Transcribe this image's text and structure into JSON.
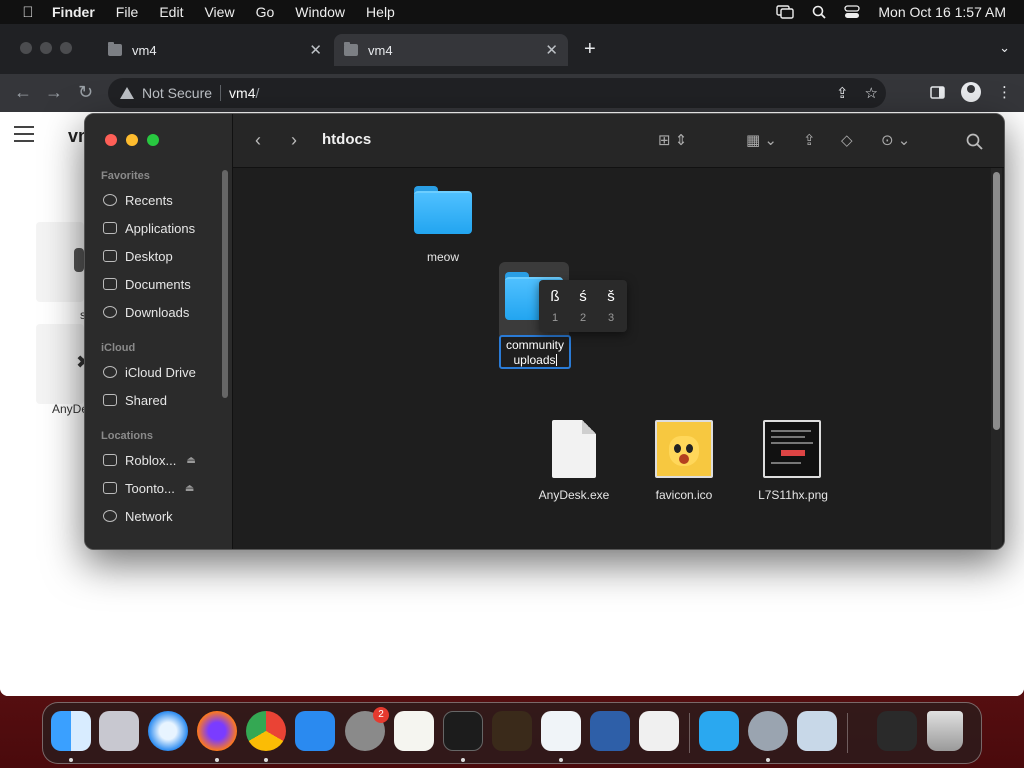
{
  "menubar": {
    "app_name": "Finder",
    "menus": [
      "File",
      "Edit",
      "View",
      "Go",
      "Window",
      "Help"
    ],
    "clock": "Mon Oct 16  1:57 AM"
  },
  "browser": {
    "tabs": [
      {
        "title": "vm4",
        "active": false
      },
      {
        "title": "vm4",
        "active": true
      }
    ],
    "address": {
      "security": "Not Secure",
      "host": "vm4",
      "path": "/"
    },
    "page": {
      "title_partial": "vm",
      "left_labels": [
        "s",
        "AnyDe"
      ]
    }
  },
  "finder": {
    "title": "htdocs",
    "sidebar": {
      "sections": [
        {
          "heading": "Favorites",
          "items": [
            {
              "label": "Recents",
              "icon": "clock-icon"
            },
            {
              "label": "Applications",
              "icon": "applications-icon"
            },
            {
              "label": "Desktop",
              "icon": "desktop-icon"
            },
            {
              "label": "Documents",
              "icon": "document-icon"
            },
            {
              "label": "Downloads",
              "icon": "download-icon"
            }
          ]
        },
        {
          "heading": "iCloud",
          "items": [
            {
              "label": "iCloud Drive",
              "icon": "cloud-icon"
            },
            {
              "label": "Shared",
              "icon": "shared-folder-icon"
            }
          ]
        },
        {
          "heading": "Locations",
          "items": [
            {
              "label": "Roblox...",
              "icon": "disk-icon"
            },
            {
              "label": "Toonto...",
              "icon": "disk-icon"
            },
            {
              "label": "Network",
              "icon": "globe-icon"
            }
          ]
        }
      ]
    },
    "items": {
      "meow": "meow",
      "rename_line1": "community",
      "rename_line2": "uploads",
      "anydesk": "AnyDesk.exe",
      "favicon": "favicon.ico",
      "png": "L7S11hx.png"
    },
    "accent_popup": [
      {
        "char": "ß",
        "num": "1"
      },
      {
        "char": "ś",
        "num": "2"
      },
      {
        "char": "š",
        "num": "3"
      }
    ]
  },
  "dock": {
    "apps": [
      "Finder",
      "Launchpad",
      "Safari",
      "Firefox",
      "Chrome",
      "App Store",
      "System Preferences",
      "TextEdit",
      "Terminal",
      "GarageBand",
      "Visual Studio Code",
      "VirtualBox",
      "Roblox",
      "Roblox Studio",
      "System Preferences",
      "Preview",
      "Downloads",
      "Trash"
    ],
    "system_prefs_badge": "2"
  }
}
